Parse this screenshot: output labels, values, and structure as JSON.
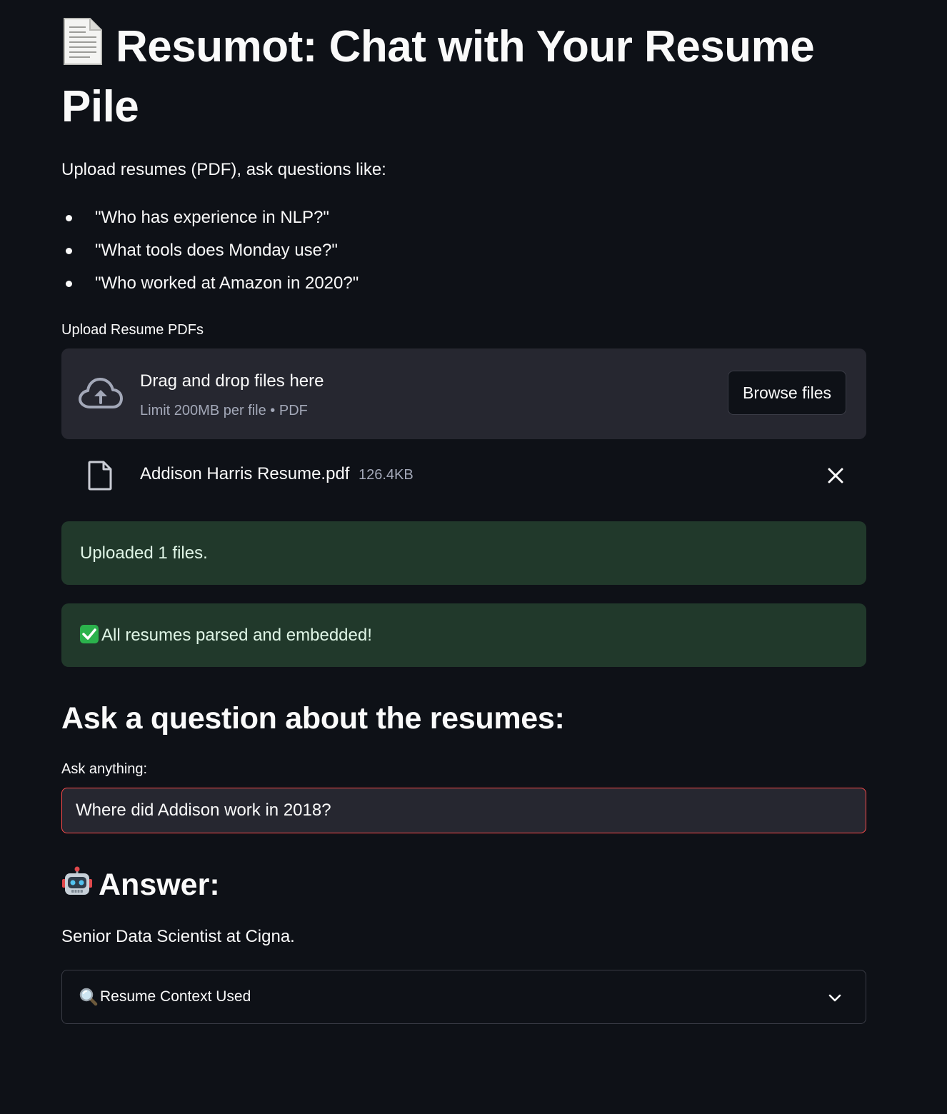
{
  "header": {
    "title": "Resumot: Chat with Your Resume Pile",
    "title_icon": "page-facing-up-icon"
  },
  "intro": {
    "text": "Upload resumes (PDF), ask questions like:",
    "examples": [
      "\"Who has experience in NLP?\"",
      "\"What tools does Monday use?\"",
      "\"Who worked at Amazon in 2020?\""
    ]
  },
  "uploader": {
    "label": "Upload Resume PDFs",
    "drop_text": "Drag and drop files here",
    "limit_text": "Limit 200MB per file • PDF",
    "browse_label": "Browse files",
    "icon": "cloud-upload-icon",
    "file": {
      "name": "Addison Harris Resume.pdf",
      "size": "126.4KB",
      "icon": "file-icon"
    }
  },
  "alerts": {
    "uploaded": "Uploaded 1 files.",
    "parsed": "All resumes parsed and embedded!",
    "parsed_icon": "check-mark-button-icon",
    "color": "#21392b"
  },
  "question": {
    "header": "Ask a question about the resumes:",
    "label": "Ask anything:",
    "value": "Where did Addison work in 2018?",
    "focus_color": "#ff4b4b"
  },
  "answer": {
    "header": "Answer:",
    "header_icon": "robot-icon",
    "text": "Senior Data Scientist at Cigna."
  },
  "expander": {
    "label": "Resume Context Used",
    "icon": "magnifying-glass-icon",
    "expanded": false
  },
  "theme": {
    "background": "#0e1117",
    "surface": "#262730",
    "text": "#fafafa",
    "muted": "#a3a8b8"
  }
}
